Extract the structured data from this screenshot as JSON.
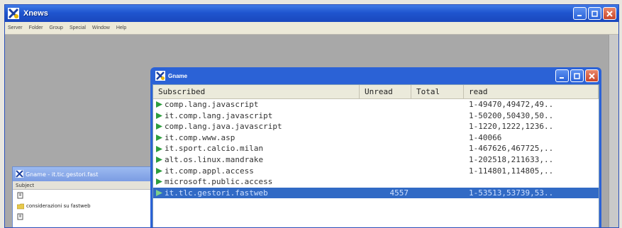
{
  "app": {
    "title": "Xnews"
  },
  "menu": [
    "Server",
    "Folder",
    "Group",
    "Special",
    "Window",
    "Help"
  ],
  "background_window": {
    "title": "Gname - it.tic.gestori.fast",
    "column_header": "Subject",
    "rows": [
      {
        "text": ""
      },
      {
        "text": "considerazioni su fastweb"
      },
      {
        "text": ""
      }
    ]
  },
  "groups_window": {
    "title": "Gname",
    "columns": [
      "Subscribed",
      "Unread",
      "Total",
      "read"
    ],
    "rows": [
      {
        "name": "comp.lang.javascript",
        "unread": "",
        "total": "",
        "read": "1-49470,49472,49.."
      },
      {
        "name": "it.comp.lang.javascript",
        "unread": "",
        "total": "",
        "read": "1-50200,50430,50.."
      },
      {
        "name": "comp.lang.java.javascript",
        "unread": "",
        "total": "",
        "read": "1-1220,1222,1236.."
      },
      {
        "name": "it.comp.www.asp",
        "unread": "",
        "total": "",
        "read": "1-40066"
      },
      {
        "name": "it.sport.calcio.milan",
        "unread": "",
        "total": "",
        "read": "1-467626,467725,.."
      },
      {
        "name": "alt.os.linux.mandrake",
        "unread": "",
        "total": "",
        "read": "1-202518,211633,.."
      },
      {
        "name": "it.comp.appl.access",
        "unread": "",
        "total": "",
        "read": "1-114801,114805,.."
      },
      {
        "name": "microsoft.public.access",
        "unread": "",
        "total": "",
        "read": ""
      },
      {
        "name": "it.tlc.gestori.fastweb",
        "unread": "4557",
        "total": "",
        "read": "1-53513,53739,53..",
        "selected": true
      }
    ]
  },
  "colors": {
    "titlebar": "#2b62d6",
    "selection": "#316ac5",
    "group_icon": "#2e9e3e"
  },
  "icons": {
    "group": "green-arrow-icon",
    "folder": "folder-icon",
    "post": "post-icon"
  }
}
